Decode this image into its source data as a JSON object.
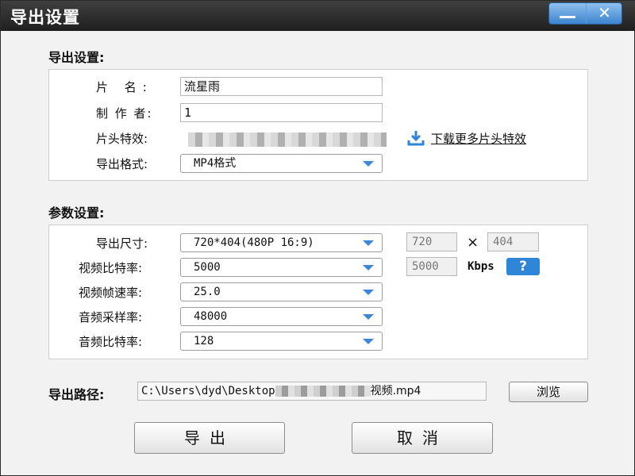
{
  "window": {
    "title": "导出设置",
    "min_label": "",
    "close_label": "✕"
  },
  "export_section": {
    "title": "导出设置:",
    "name_label": "片 名:",
    "name_value": "流星雨",
    "author_label": "制 作 者:",
    "author_value": "1",
    "intro_label": "片头特效:",
    "download_link": "下载更多片头特效",
    "format_label": "导出格式:",
    "format_value": "MP4格式"
  },
  "param_section": {
    "title": "参数设置:",
    "size_label": "导出尺寸:",
    "size_value": "720*404(480P 16:9)",
    "width_value": "720",
    "times": "×",
    "height_value": "404",
    "vbitrate_label": "视频比特率:",
    "vbitrate_value": "5000",
    "vbitrate_custom": "5000",
    "kbps": "Kbps",
    "help": "?",
    "fps_label": "视频帧速率:",
    "fps_value": "25.0",
    "samplerate_label": "音频采样率:",
    "samplerate_value": "48000",
    "abitrate_label": "音频比特率:",
    "abitrate_value": "128"
  },
  "path": {
    "label": "导出路径:",
    "value_prefix": "C:\\Users\\dyd\\Desktop",
    "value_suffix": "视频.mp4",
    "browse_label": "浏览"
  },
  "actions": {
    "export_label": "导出",
    "cancel_label": "取消"
  },
  "colors": {
    "accent": "#2f86d8",
    "titlebar": "#2a2a2a"
  }
}
